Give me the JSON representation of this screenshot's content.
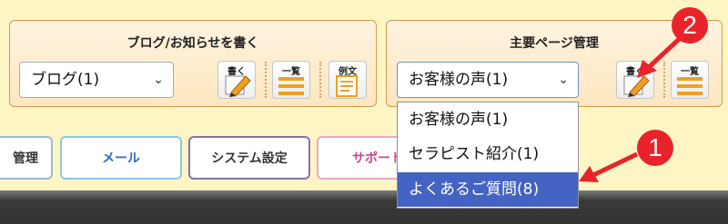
{
  "colors": {
    "background": "#fdf6c4",
    "panel_border": "#d29a4e",
    "accent_red": "#e8242a",
    "selected_blue": "#4463c2"
  },
  "blog_panel": {
    "title": "ブログ/お知らせを書く",
    "select_value": "ブログ(1)",
    "buttons": [
      {
        "label": "書く",
        "icon": "pen-paper-icon"
      },
      {
        "label": "一覧",
        "icon": "list-icon"
      },
      {
        "label": "例文",
        "icon": "document-icon"
      }
    ]
  },
  "page_panel": {
    "title": "主要ページ管理",
    "select_value": "お客様の声(1)",
    "buttons": [
      {
        "label": "書く",
        "icon": "pen-paper-icon"
      },
      {
        "label": "一覧",
        "icon": "list-icon"
      }
    ]
  },
  "dropdown_options": [
    {
      "label": "お客様の声(1)",
      "selected": false
    },
    {
      "label": "セラピスト紹介(1)",
      "selected": false
    },
    {
      "label": "よくあるご質問(8)",
      "selected": true
    }
  ],
  "nav_tabs": [
    {
      "label": "管理",
      "color": "#333333"
    },
    {
      "label": "メール",
      "color": "#2a6cc2"
    },
    {
      "label": "システム設定",
      "color": "#333333"
    },
    {
      "label": "サポート",
      "color": "#c24c8c"
    }
  ],
  "annotations": [
    {
      "number": "1"
    },
    {
      "number": "2"
    }
  ]
}
